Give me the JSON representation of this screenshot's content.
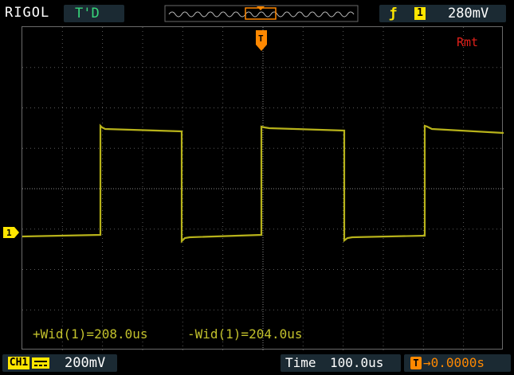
{
  "top_bar": {
    "brand": "RIGOL",
    "trigger_status": "T'D",
    "trigger_edge_icon": "rising-edge-icon",
    "trigger_source": "1",
    "trigger_level": "280mV"
  },
  "screen": {
    "remote_label": "Rmt",
    "trigger_position_label": "T",
    "channel_marker_label": "1",
    "trace_color": "#b7b21a"
  },
  "measurements": {
    "positive_width": "+Wid(1)=208.0us",
    "negative_width": "-Wid(1)=204.0us"
  },
  "bottom_bar": {
    "channel_label": "CH1",
    "coupling_icon": "dc-coupling-icon",
    "channel_scale": "200mV",
    "time_label": "Time",
    "time_scale": "100.0us",
    "offset_icon": "T",
    "trigger_offset": "→0.0000s"
  },
  "colors": {
    "trace": "#b7b21a",
    "trigger": "#ff8800",
    "channel": "#ffe600",
    "status": "#37d67a",
    "remote": "#e0201a"
  }
}
